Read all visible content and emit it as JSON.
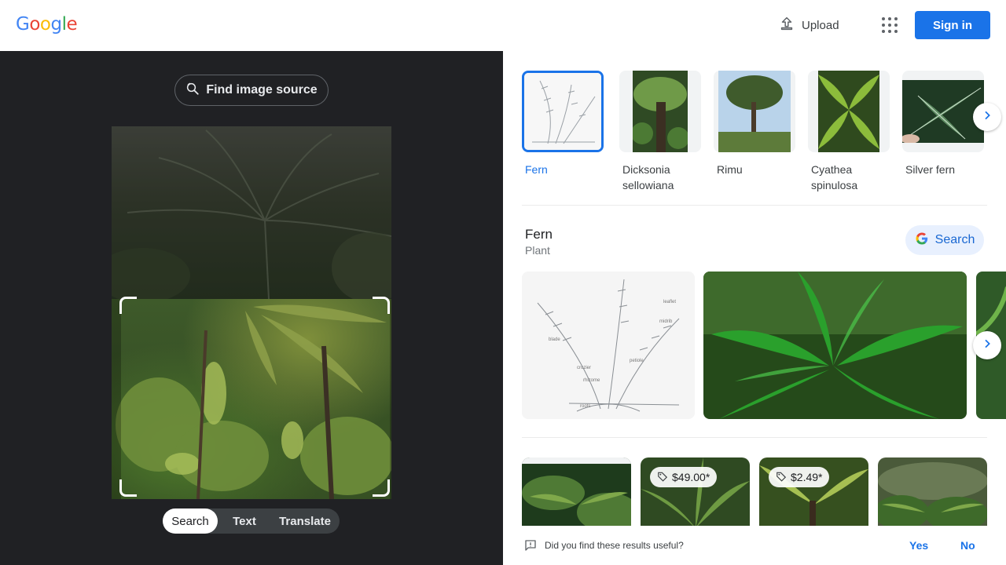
{
  "header": {
    "logo_letters": [
      "G",
      "o",
      "o",
      "g",
      "l",
      "e"
    ],
    "logo_colors": [
      "#4285f4",
      "#ea4335",
      "#fbbc05",
      "#4285f4",
      "#34a853",
      "#ea4335"
    ],
    "upload_label": "Upload",
    "apps_icon": "apps-grid-icon",
    "signin_label": "Sign in"
  },
  "lens": {
    "find_source_label": "Find image source",
    "modes": [
      {
        "label": "Search",
        "active": true
      },
      {
        "label": "Text",
        "active": false
      },
      {
        "label": "Translate",
        "active": false
      }
    ]
  },
  "related_chips": [
    {
      "label": "Fern",
      "selected": true
    },
    {
      "label": "Dicksonia sellowiana",
      "selected": false
    },
    {
      "label": "Rimu",
      "selected": false
    },
    {
      "label": "Cyathea spinulosa",
      "selected": false
    },
    {
      "label": "Silver fern",
      "selected": false
    }
  ],
  "knowledge": {
    "title": "Fern",
    "subtitle": "Plant",
    "search_label": "Search"
  },
  "results": [
    {
      "price": ""
    },
    {
      "price": "$49.00*"
    },
    {
      "price": "$2.49*"
    },
    {
      "price": ""
    }
  ],
  "feedback": {
    "question": "Did you find these results useful?",
    "yes": "Yes",
    "no": "No"
  },
  "colors": {
    "accent": "#1a73e8",
    "dark_bg": "#202124"
  }
}
